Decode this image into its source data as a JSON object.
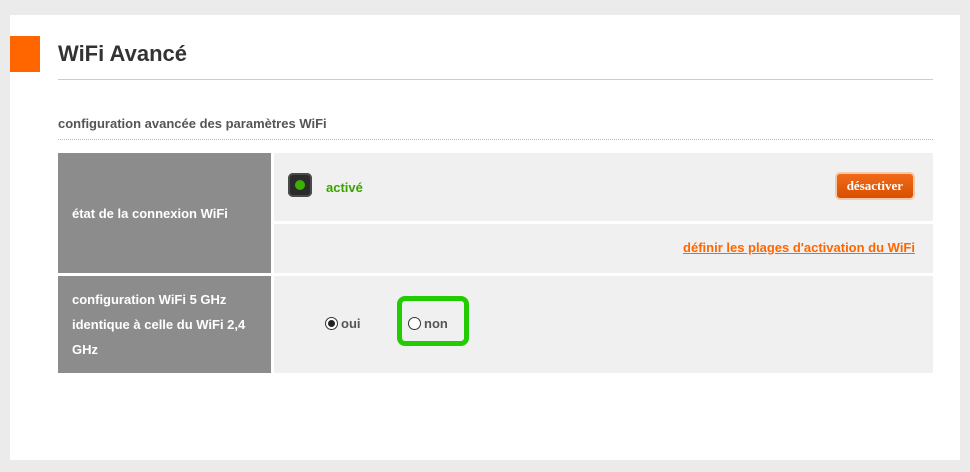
{
  "page": {
    "title": "WiFi Avancé",
    "section_heading": "configuration avancée des paramètres WiFi"
  },
  "wifi_connection": {
    "label": "état de la connexion WiFi",
    "status": "activé",
    "status_color": "#3ca000",
    "deactivate_button": "désactiver",
    "schedule_link": "définir les plages d'activation du WiFi"
  },
  "wifi_5ghz": {
    "label": "configuration WiFi 5 GHz identique à celle du WiFi 2,4 GHz",
    "options": [
      {
        "label": "oui",
        "checked": true
      },
      {
        "label": "non",
        "checked": false
      }
    ]
  },
  "colors": {
    "accent": "#ff6600",
    "label_bg": "#8c8c8c",
    "highlight": "#22cc00"
  }
}
